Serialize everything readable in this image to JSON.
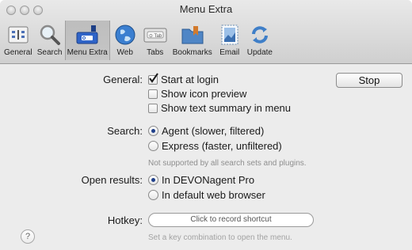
{
  "window": {
    "title": "Menu Extra"
  },
  "toolbar": {
    "items": [
      {
        "label": "General",
        "icon": "general-prefs-icon"
      },
      {
        "label": "Search",
        "icon": "magnifier-icon"
      },
      {
        "label": "Menu Extra",
        "icon": "menu-extra-icon"
      },
      {
        "label": "Web",
        "icon": "globe-icon"
      },
      {
        "label": "Tabs",
        "icon": "tabs-icon"
      },
      {
        "label": "Bookmarks",
        "icon": "bookmarks-folder-icon"
      },
      {
        "label": "Email",
        "icon": "email-stamp-icon"
      },
      {
        "label": "Update",
        "icon": "update-arrows-icon"
      }
    ],
    "selected": "Menu Extra"
  },
  "general": {
    "label": "General:",
    "options": [
      {
        "label": "Start at login",
        "checked": true
      },
      {
        "label": "Show icon preview",
        "checked": false
      },
      {
        "label": "Show text summary in menu",
        "checked": false
      }
    ],
    "stop_button": "Stop"
  },
  "search": {
    "label": "Search:",
    "options": [
      {
        "label": "Agent (slower, filtered)",
        "selected": true
      },
      {
        "label": "Express (faster, unfiltered)",
        "selected": false
      }
    ],
    "note": "Not supported by all search sets and plugins."
  },
  "open_results": {
    "label": "Open results:",
    "options": [
      {
        "label": "In DEVONagent Pro",
        "selected": true
      },
      {
        "label": "In default web browser",
        "selected": false
      }
    ]
  },
  "hotkey": {
    "label": "Hotkey:",
    "placeholder": "Click to record shortcut",
    "note": "Set a key combination to open the menu."
  },
  "help_button": "?",
  "colors": {
    "accent": "#1f3f8a",
    "window_bg": "#ececec"
  }
}
